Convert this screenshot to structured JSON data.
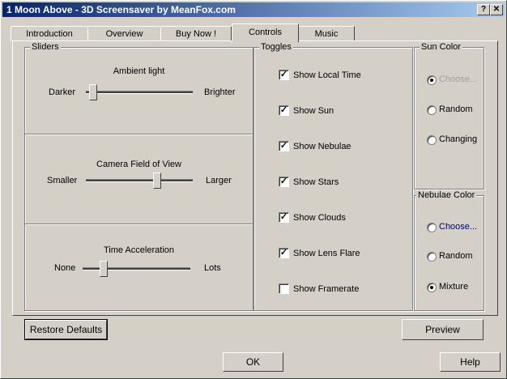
{
  "window": {
    "title": "1 Moon Above - 3D Screensaver by MeanFox.com"
  },
  "title_buttons": {
    "help": "?",
    "close": "✕"
  },
  "tabs": [
    {
      "label": "Introduction"
    },
    {
      "label": "Overview"
    },
    {
      "label": "Buy Now !"
    },
    {
      "label": "Controls"
    },
    {
      "label": "Music"
    }
  ],
  "sliders": {
    "group_label": "Sliders",
    "ambient": {
      "title": "Ambient light",
      "min_label": "Darker",
      "max_label": "Brighter",
      "value": 0.03
    },
    "fov": {
      "title": "Camera Field of View",
      "min_label": "Smaller",
      "max_label": "Larger",
      "value": 0.68
    },
    "time": {
      "title": "Time Acceleration",
      "min_label": "None",
      "max_label": "Lots",
      "value": 0.17
    }
  },
  "toggles": {
    "group_label": "Toggles",
    "items": [
      {
        "label": "Show Local Time",
        "checked": true,
        "check": "✓"
      },
      {
        "label": "Show Sun",
        "checked": true,
        "check": "✓"
      },
      {
        "label": "Show Nebulae",
        "checked": true,
        "check": "✓"
      },
      {
        "label": "Show Stars",
        "checked": true,
        "check": "✓"
      },
      {
        "label": "Show Clouds",
        "checked": true,
        "check": "✓"
      },
      {
        "label": "Show Lens Flare",
        "checked": true,
        "check": "✓"
      },
      {
        "label": "Show Framerate",
        "checked": false,
        "check": ""
      }
    ]
  },
  "sun_color": {
    "group_label": "Sun Color",
    "options": [
      {
        "label": "Choose...",
        "selected": true,
        "disabled": true
      },
      {
        "label": "Random",
        "selected": false
      },
      {
        "label": "Changing",
        "selected": false
      }
    ]
  },
  "nebulae_color": {
    "group_label": "Nebulae Color",
    "options": [
      {
        "label": "Choose...",
        "selected": false,
        "link": true
      },
      {
        "label": "Random",
        "selected": false
      },
      {
        "label": "Mixture",
        "selected": true
      }
    ]
  },
  "buttons": {
    "restore_defaults": "Restore Defaults",
    "preview": "Preview",
    "ok": "OK",
    "help": "Help"
  },
  "colors": {
    "disabled_text": "#a0a0a0",
    "link_text": "#000080"
  }
}
